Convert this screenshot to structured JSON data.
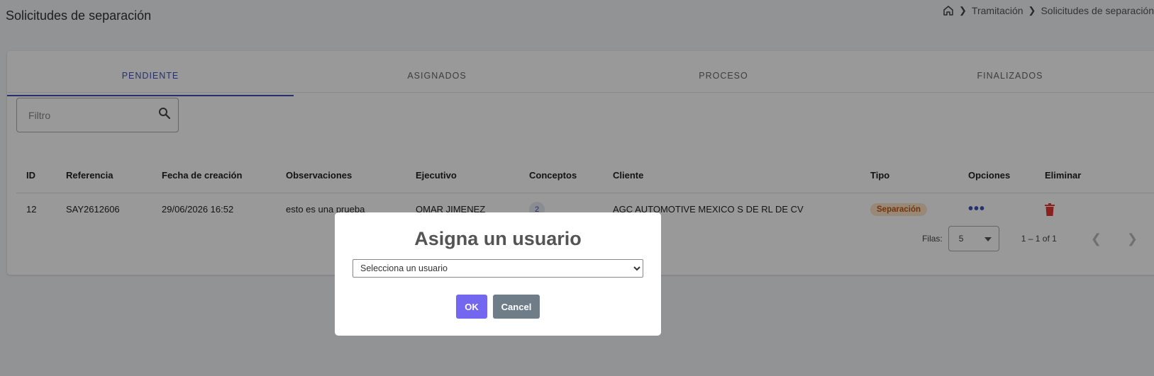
{
  "page": {
    "title": "Solicitudes de separación"
  },
  "breadcrumb": {
    "items": [
      "Tramitación",
      "Solicitudes de separación"
    ]
  },
  "tabs": [
    {
      "label": "PENDIENTE",
      "active": true
    },
    {
      "label": "ASIGNADOS",
      "active": false
    },
    {
      "label": "PROCESO",
      "active": false
    },
    {
      "label": "FINALIZADOS",
      "active": false
    }
  ],
  "filter": {
    "placeholder": "Filtro",
    "icon": "search-icon"
  },
  "table": {
    "headers": [
      "ID",
      "Referencia",
      "Fecha de creación",
      "Observaciones",
      "Ejecutivo",
      "Conceptos",
      "Cliente",
      "Tipo",
      "Opciones",
      "Eliminar"
    ],
    "rows": [
      {
        "id": "12",
        "referencia": "SAY2612606",
        "fecha": "29/06/2026 16:52",
        "observaciones": "esto es una prueba",
        "ejecutivo": "OMAR JIMENEZ",
        "conceptos": "2",
        "cliente": "AGC AUTOMOTIVE MEXICO S DE RL DE CV",
        "tipo": "Separación",
        "opciones": "•••"
      }
    ]
  },
  "paginator": {
    "rows_label": "Filas:",
    "rows_value": "5",
    "range": "1 – 1 of 1"
  },
  "modal": {
    "title": "Asigna un usuario",
    "select_value": "Selecciona un usuario",
    "ok_label": "OK",
    "cancel_label": "Cancel"
  },
  "colors": {
    "accent": "#3f51b5",
    "ok_button": "#7367f0",
    "cancel_button": "#6e7d88",
    "delete_icon": "#e53935",
    "tipo_badge_bg": "#fde3c9",
    "tipo_badge_text": "#c2570c"
  }
}
